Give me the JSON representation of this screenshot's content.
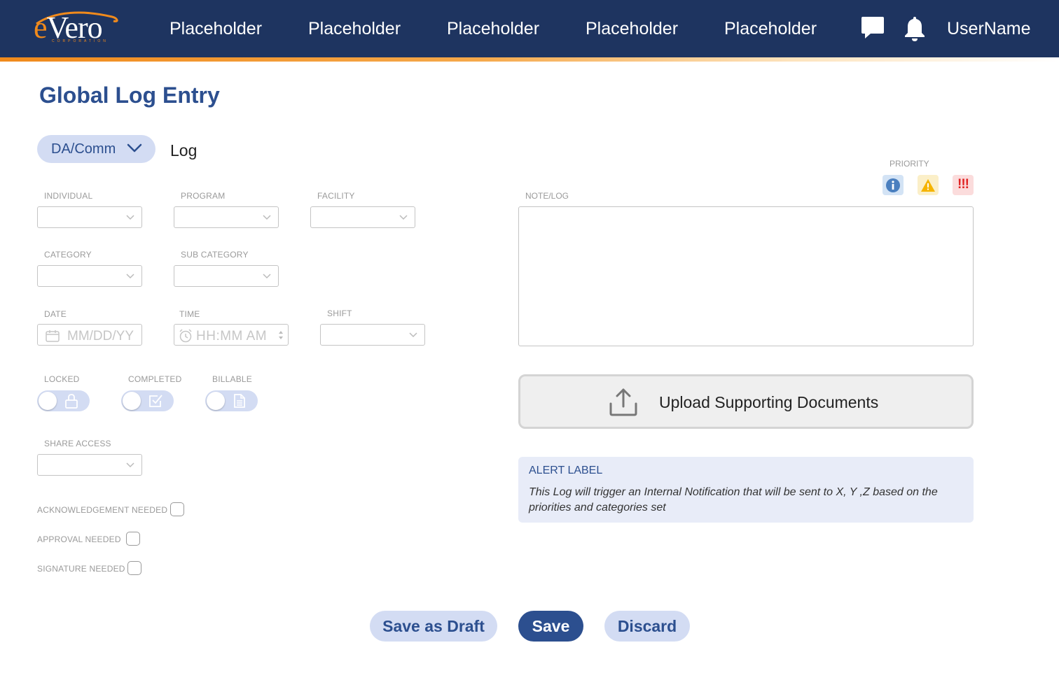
{
  "header": {
    "logo_text": "eVero",
    "logo_subtext": "CORPORATION",
    "nav": [
      "Placeholder",
      "Placeholder",
      "Placeholder",
      "Placeholder",
      "Placeholder"
    ],
    "username": "UserName",
    "icons": [
      "chat-icon",
      "bell-icon"
    ]
  },
  "page": {
    "title": "Global Log Entry",
    "type_dropdown": "DA/Comm",
    "type_label": "Log"
  },
  "form": {
    "individual_label": "INDIVIDUAL",
    "program_label": "PROGRAM",
    "facility_label": "FACILITY",
    "category_label": "CATEGORY",
    "subcategory_label": "SUB CATEGORY",
    "date_label": "DATE",
    "date_placeholder": "MM/DD/YY",
    "time_label": "TIME",
    "time_placeholder": "HH:MM AM",
    "shift_label": "SHIFT",
    "locked_label": "LOCKED",
    "completed_label": "COMPLETED",
    "billable_label": "BILLABLE",
    "share_access_label": "SHARE ACCESS",
    "ack_label": "ACKNOWLEDGEMENT NEEDED",
    "approval_label": "APPROVAL NEEDED",
    "signature_label": "SIGNATURE NEEDED"
  },
  "right": {
    "priority_label": "PRIORITY",
    "priority_high": "!!!",
    "note_label": "NOTE/LOG",
    "upload_label": "Upload Supporting Documents",
    "alert_title": "ALERT LABEL",
    "alert_message": "This Log will trigger an Internal Notification that will be sent to X, Y ,Z based on the priorities and categories set"
  },
  "actions": {
    "draft": "Save as Draft",
    "save": "Save",
    "discard": "Discard"
  },
  "colors": {
    "header_bg": "#1e3460",
    "accent_orange": "#f08a1c",
    "primary_blue": "#2c4f8f",
    "light_blue": "#d3dcf3"
  }
}
